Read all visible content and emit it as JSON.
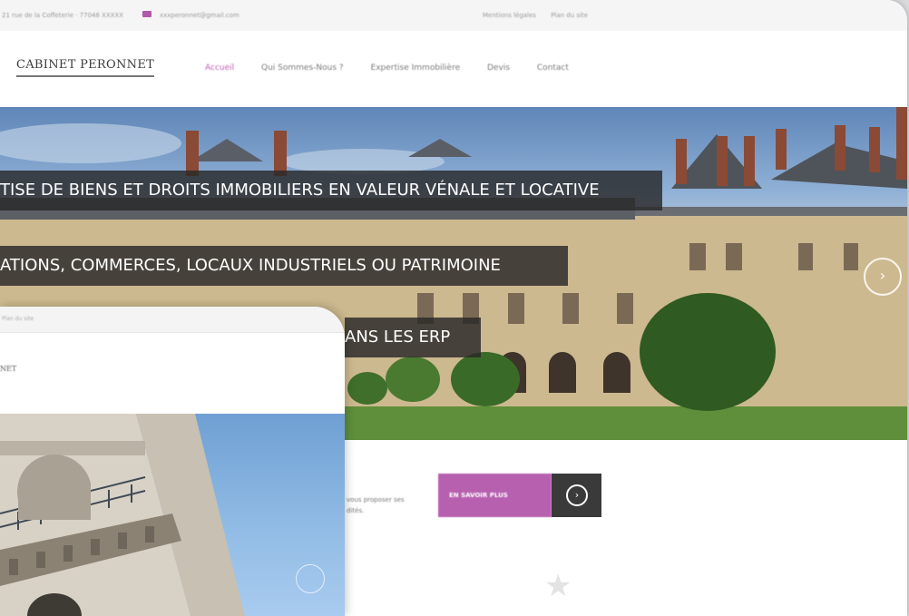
{
  "topbar": {
    "address": "21 rue de la Coffeterie · 77048 XXXXX",
    "email": "xxxperonnet@gmail.com",
    "links": [
      "Mentions légales",
      "Plan du site"
    ]
  },
  "header": {
    "logo": "CABINET PERONNET",
    "nav": [
      "Accueil",
      "Qui Sommes-Nous ?",
      "Expertise Immobilière",
      "Devis",
      "Contact"
    ],
    "active_nav": "Accueil"
  },
  "hero": {
    "banner_1": "TISE DE BIENS ET DROITS IMMOBILIERS EN VALEUR VÉNALE ET LOCATIVE",
    "banner_2": "ATIONS, COMMERCES, LOCAUX INDUSTRIELS OU PATRIMOINE",
    "banner_3": "ANS LES ERP",
    "next_icon": "chevron-right-circle-icon"
  },
  "promo": {
    "text_line_1": "vous proposer ses",
    "text_line_2": "dités.",
    "cta_label": "EN SAVOIR PLUS",
    "cta_icon": "chevron-right-circle-icon"
  },
  "front_window": {
    "topbar_links": "Plan du site",
    "logo_fragment": "NET"
  },
  "colors": {
    "accent": "#b760b0",
    "dark": "#3a3a3a"
  }
}
